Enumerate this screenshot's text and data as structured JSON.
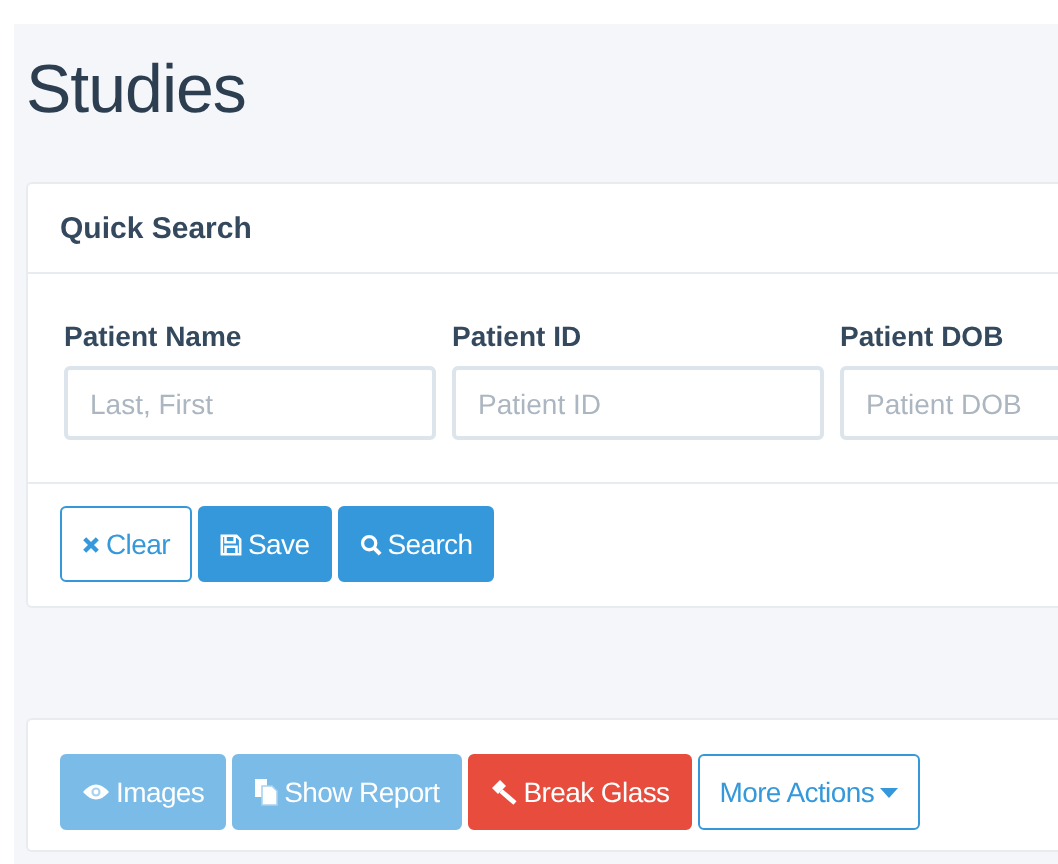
{
  "page": {
    "title": "Studies"
  },
  "quick_search": {
    "title": "Quick Search",
    "fields": [
      {
        "label": "Patient Name",
        "placeholder": "Last, First"
      },
      {
        "label": "Patient ID",
        "placeholder": "Patient ID"
      },
      {
        "label": "Patient DOB",
        "placeholder": "Patient DOB"
      }
    ],
    "buttons": [
      {
        "label": "Clear",
        "kind": "outline",
        "disabled": false
      },
      {
        "label": "Save",
        "kind": "primary",
        "disabled": false
      },
      {
        "label": "Search",
        "kind": "primary",
        "disabled": false
      }
    ]
  },
  "actions": [
    {
      "label": "Images",
      "kind": "primary",
      "disabled": true
    },
    {
      "label": "Show Report",
      "kind": "primary",
      "disabled": true
    },
    {
      "label": "Break Glass",
      "kind": "danger",
      "disabled": false
    },
    {
      "label": "More Actions",
      "kind": "outline",
      "disabled": false
    }
  ]
}
